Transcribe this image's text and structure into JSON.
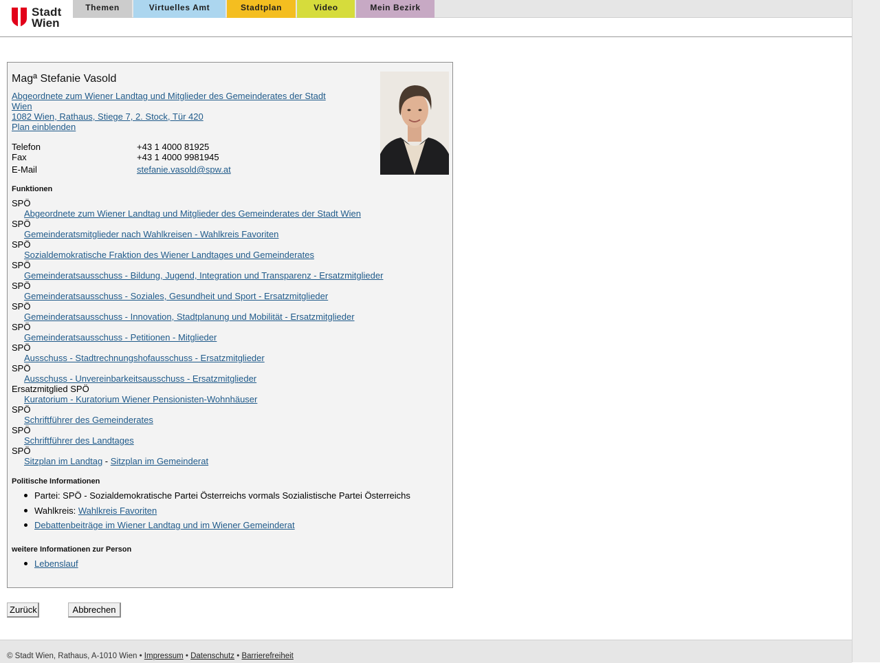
{
  "header": {
    "logo": {
      "line1": "Stadt",
      "line2": "Wien"
    },
    "tabs": [
      {
        "label": "Themen",
        "color": "#cccccc"
      },
      {
        "label": "Virtuelles Amt",
        "color": "#acd6ef"
      },
      {
        "label": "Stadtplan",
        "color": "#f4be20"
      },
      {
        "label": "Video",
        "color": "#d6dc3c"
      },
      {
        "label": "Mein Bezirk",
        "color": "#c7a9c4"
      }
    ]
  },
  "person": {
    "name": "Magª Stefanie Vasold",
    "role_link": "Abgeordnete zum Wiener Landtag und Mitglieder des Gemeinderates der Stadt Wien",
    "address_link": "1082 Wien, Rathaus, Stiege 7, 2. Stock, Tür 420",
    "map_link": "Plan einblenden",
    "contact": {
      "phone_label": "Telefon",
      "phone": "+43 1 4000 81925",
      "fax_label": "Fax",
      "fax": "+43 1 4000 9981945",
      "email_label": "E-Mail",
      "email": "stefanie.vasold@spw.at"
    }
  },
  "functions": {
    "heading": "Funktionen",
    "items": [
      {
        "party": "SPÖ",
        "link": "Abgeordnete zum Wiener Landtag und Mitglieder des Gemeinderates der Stadt Wien"
      },
      {
        "party": "SPÖ",
        "link": "Gemeinderatsmitglieder nach Wahlkreisen - Wahlkreis Favoriten"
      },
      {
        "party": "SPÖ",
        "link": "Sozialdemokratische Fraktion des Wiener Landtages und Gemeinderates"
      },
      {
        "party": "SPÖ",
        "link": "Gemeinderatsausschuss - Bildung, Jugend, Integration und Transparenz - Ersatzmitglieder"
      },
      {
        "party": "SPÖ",
        "link": "Gemeinderatsausschuss - Soziales, Gesundheit und Sport - Ersatzmitglieder"
      },
      {
        "party": "SPÖ",
        "link": "Gemeinderatsausschuss - Innovation, Stadtplanung und Mobilität - Ersatzmitglieder"
      },
      {
        "party": "SPÖ",
        "link": "Gemeinderatsausschuss - Petitionen - Mitglieder"
      },
      {
        "party": "SPÖ",
        "link": "Ausschuss - Stadtrechnungshofausschuss - Ersatzmitglieder"
      },
      {
        "party": "SPÖ",
        "link": "Ausschuss - Unvereinbarkeitsausschuss - Ersatzmitglieder"
      },
      {
        "party": "Ersatzmitglied SPÖ",
        "link": "Kuratorium - Kuratorium Wiener Pensionisten-Wohnhäuser"
      },
      {
        "party": "SPÖ",
        "link": "Schriftführer des Gemeinderates"
      },
      {
        "party": "SPÖ",
        "link": "Schriftführer des Landtages"
      }
    ],
    "last": {
      "party": "SPÖ",
      "link1": "Sitzplan im Landtag",
      "separator": " - ",
      "link2": "Sitzplan im Gemeinderat"
    }
  },
  "political": {
    "heading": "Politische Informationen",
    "party_text": "Partei: SPÖ - Sozialdemokratische Partei Österreichs vormals Sozialistische Partei Österreichs",
    "wahlkreis_label": "Wahlkreis: ",
    "wahlkreis_link": "Wahlkreis Favoriten",
    "debate_link": "Debattenbeiträge im Wiener Landtag und im Wiener Gemeinderat"
  },
  "more": {
    "heading": "weitere Informationen zur Person",
    "cv_link": "Lebenslauf"
  },
  "buttons": {
    "back": "Zurück",
    "cancel": "Abbrechen"
  },
  "footer": {
    "copyright": "© Stadt Wien, Rathaus, A-1010 Wien",
    "bullet": " • ",
    "impressum": "Impressum",
    "datenschutz": "Datenschutz",
    "barrierefreiheit": "Barrierefreiheit"
  },
  "colors": {
    "link": "#1f5a8a",
    "logo_red": "#e2001a"
  }
}
